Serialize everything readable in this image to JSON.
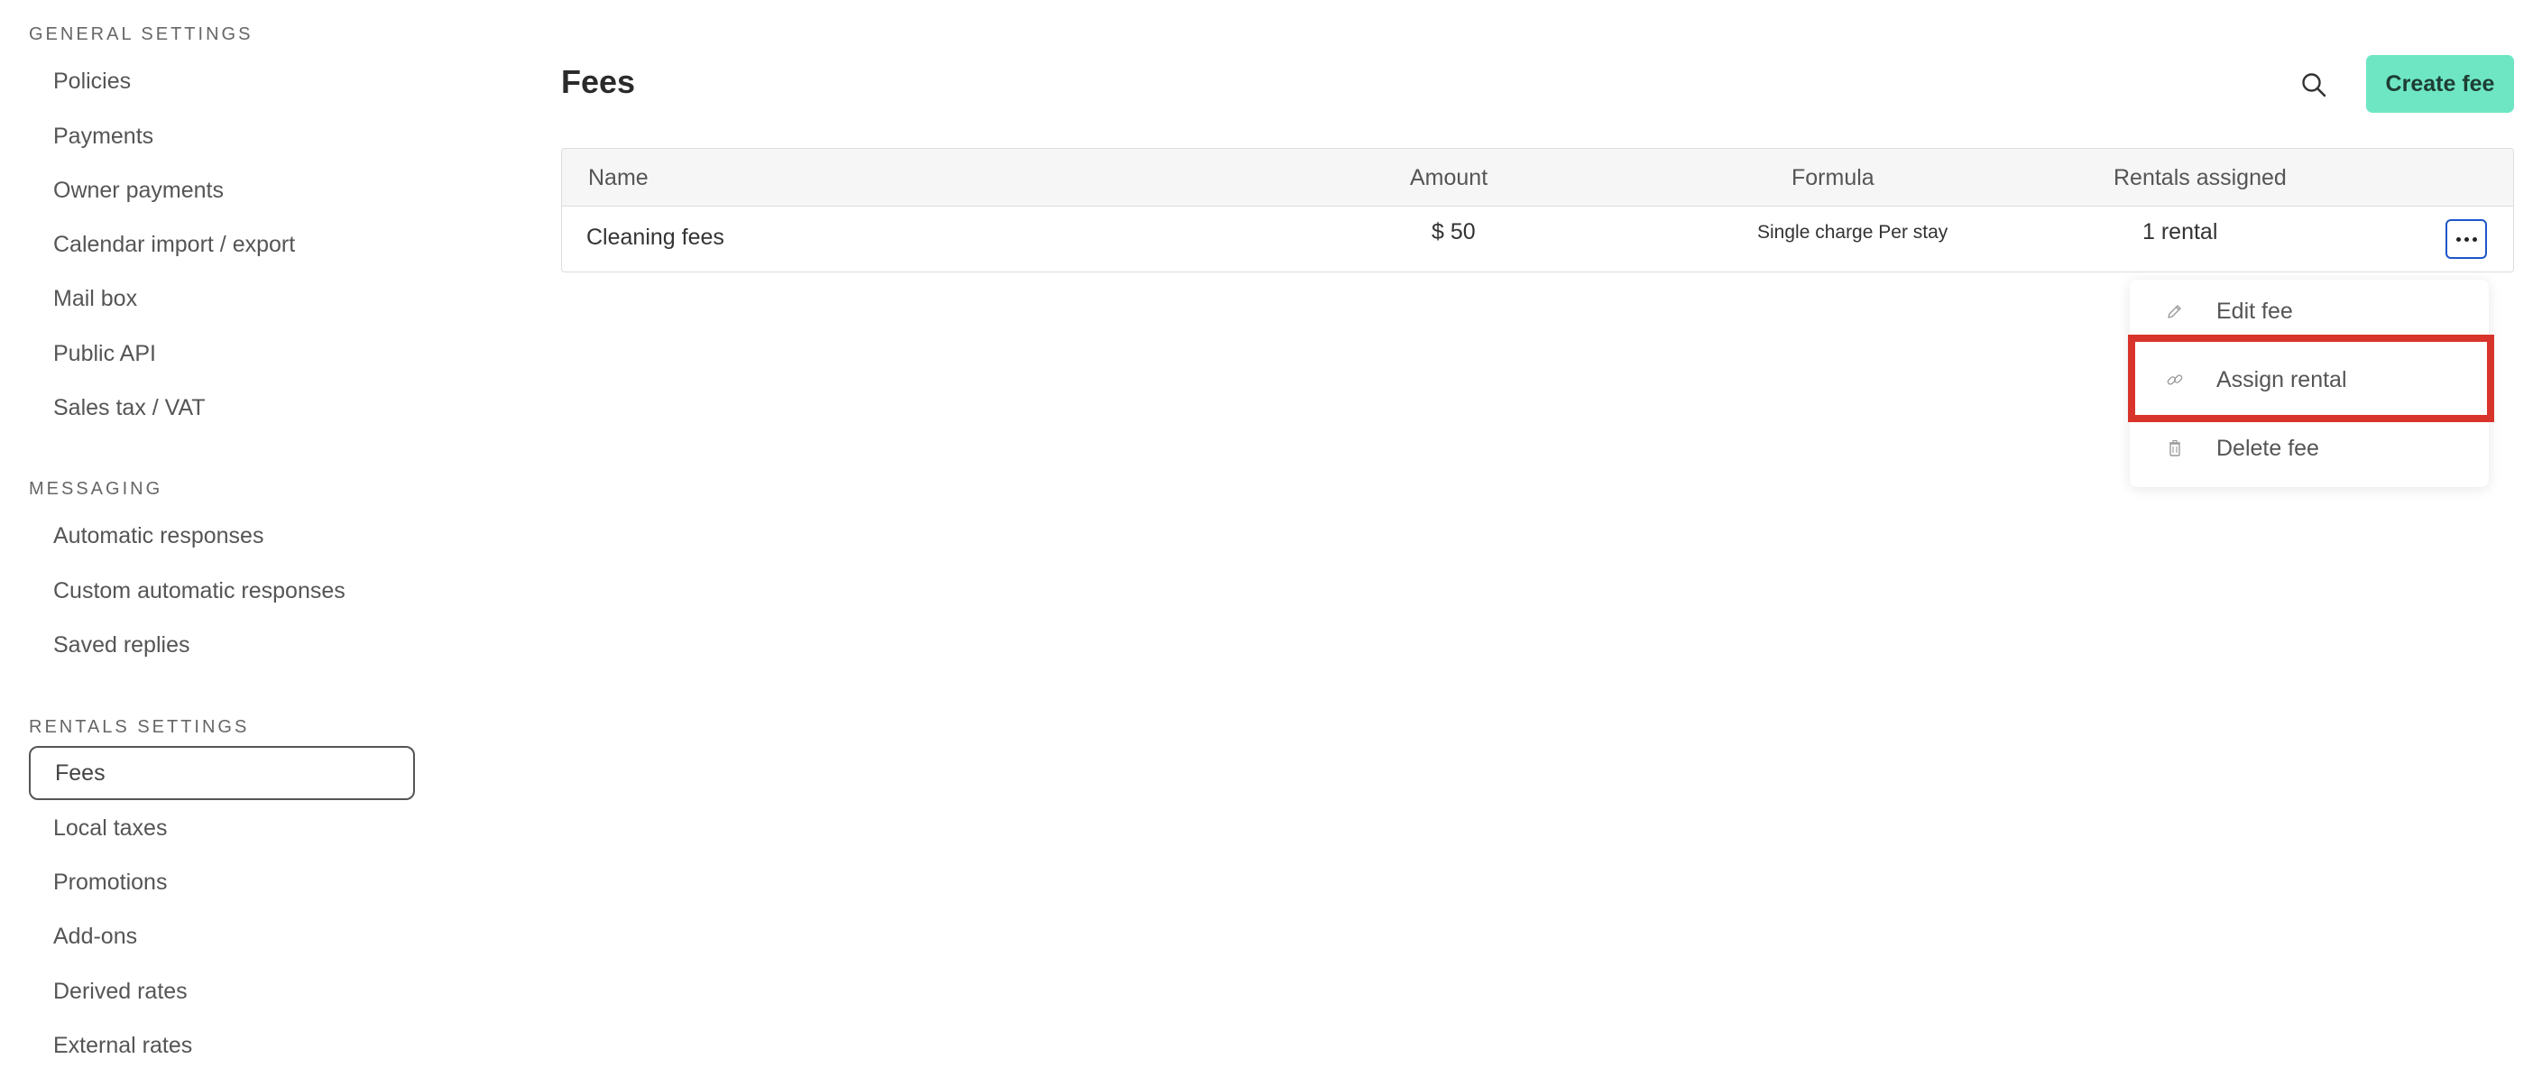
{
  "sidebar": {
    "sections": [
      {
        "title": "GENERAL SETTINGS",
        "items": [
          "Policies",
          "Payments",
          "Owner payments",
          "Calendar import / export",
          "Mail box",
          "Public API",
          "Sales tax / VAT"
        ]
      },
      {
        "title": "MESSAGING",
        "items": [
          "Automatic responses",
          "Custom automatic responses",
          "Saved replies"
        ]
      },
      {
        "title": "RENTALS SETTINGS",
        "items": [
          "Fees",
          "Local taxes",
          "Promotions",
          "Add-ons",
          "Derived rates",
          "External rates"
        ]
      }
    ],
    "active_item": "Fees"
  },
  "header": {
    "title": "Fees",
    "search_icon": "search-icon",
    "create_label": "Create fee",
    "accent": "#6ee6c4"
  },
  "table": {
    "columns": [
      "Name",
      "Amount",
      "Formula",
      "Rentals assigned"
    ],
    "rows": [
      {
        "name": "Cleaning fees",
        "amount": "$ 50",
        "formula": "Single charge Per stay",
        "rentals": "1 rental"
      }
    ],
    "more_icon": "more-horizontal-icon"
  },
  "menu": {
    "items": [
      {
        "icon": "pencil-icon",
        "label": "Edit fee"
      },
      {
        "icon": "link-icon",
        "label": "Assign rental"
      },
      {
        "icon": "trash-icon",
        "label": "Delete fee"
      }
    ],
    "highlight_color": "#d9342b"
  }
}
